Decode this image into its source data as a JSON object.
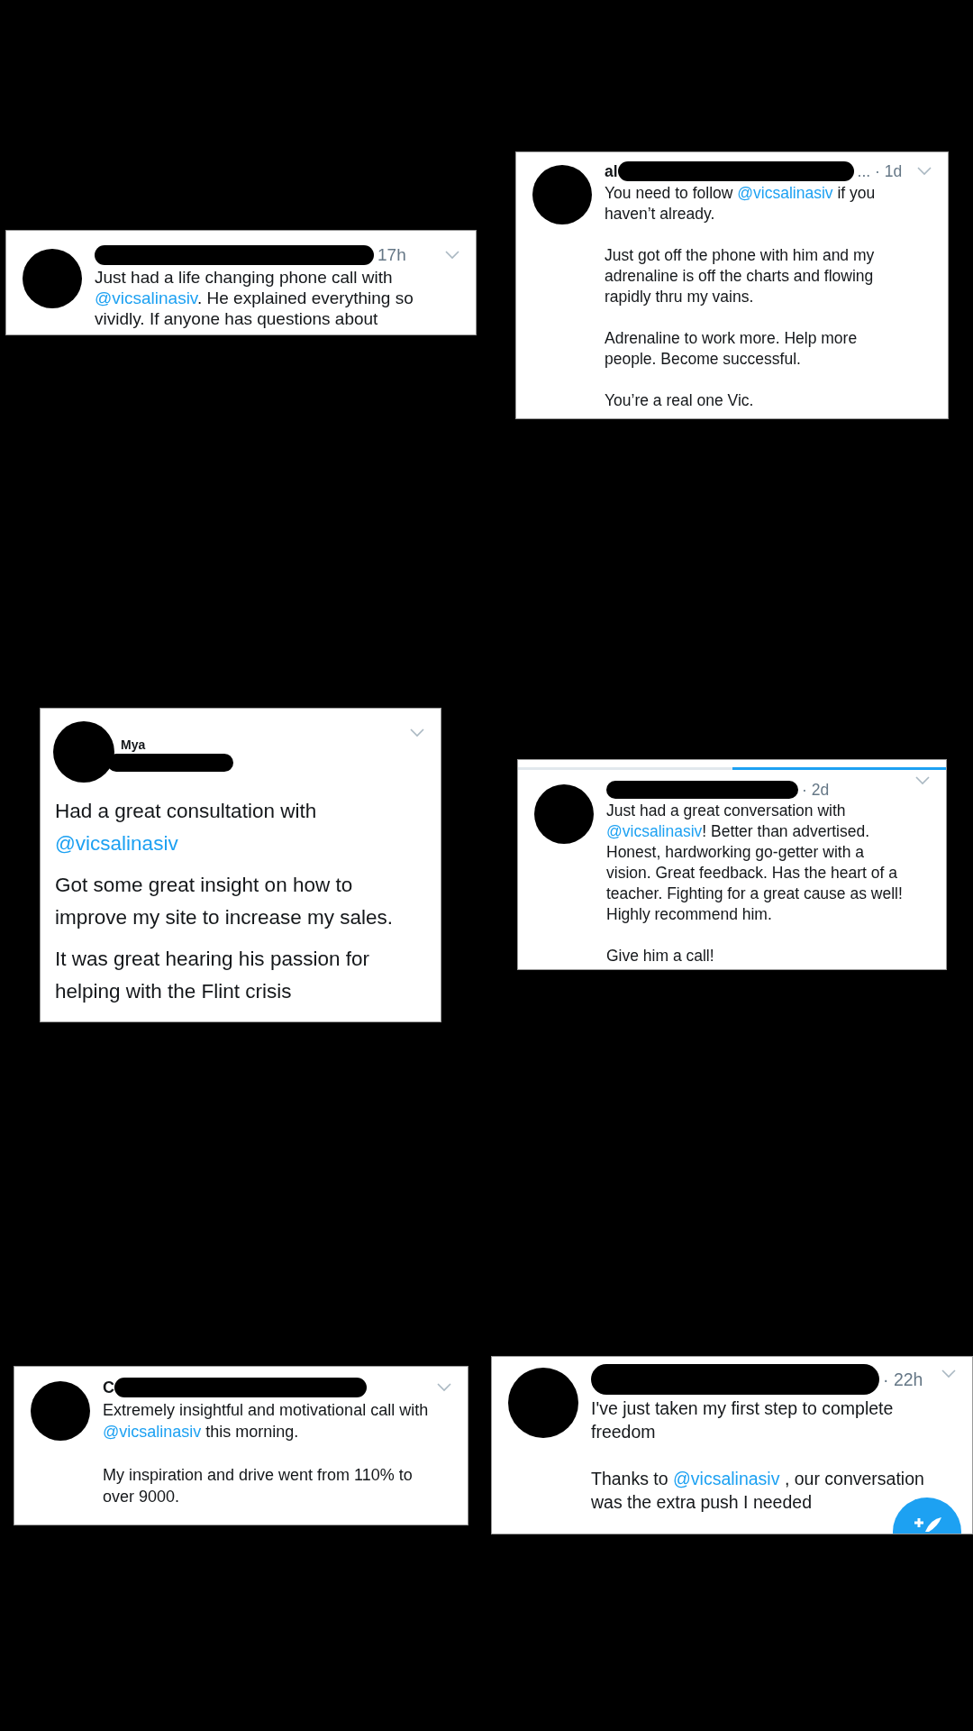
{
  "tweets": [
    {
      "kind": "compact",
      "redacted": true,
      "time": "17h",
      "paragraphs": [
        [
          {
            "kind": "text",
            "text": "Just had a life changing phone call with "
          },
          {
            "kind": "mention",
            "text": "@vicsalinasiv"
          },
          {
            "kind": "text",
            "text": ". He explained everything so vividly. If anyone has questions about"
          }
        ]
      ]
    },
    {
      "kind": "compact",
      "name": "al",
      "redacted": true,
      "time": "... · 1d",
      "paragraphs": [
        [
          {
            "kind": "text",
            "text": "You need to follow "
          },
          {
            "kind": "mention",
            "text": "@vicsalinasiv"
          },
          {
            "kind": "text",
            "text": " if you haven’t already."
          }
        ],
        [
          {
            "kind": "text",
            "text": "Just got off the phone with him and my adrenaline is off the charts and flowing rapidly thru my vains."
          }
        ],
        [
          {
            "kind": "text",
            "text": "Adrenaline to work more. Help more people. Become successful."
          }
        ],
        [
          {
            "kind": "text",
            "text": "You’re a real one Vic."
          }
        ]
      ]
    },
    {
      "kind": "large",
      "name": "Mya",
      "redacted": true,
      "paragraphs": [
        [
          {
            "kind": "text",
            "text": "Had a great consultation with "
          },
          {
            "kind": "mention",
            "text": "@vicsalinasiv"
          }
        ],
        [
          {
            "kind": "text",
            "text": "Got some great insight on how to improve my site to increase my sales."
          }
        ],
        [
          {
            "kind": "text",
            "text": "It was great hearing his passion for helping with the Flint crisis"
          }
        ]
      ]
    },
    {
      "kind": "compact",
      "redacted": true,
      "time": "· 2d",
      "tab_strip": [
        {
          "selected": false
        },
        {
          "selected": true
        }
      ],
      "paragraphs": [
        [
          {
            "kind": "text",
            "text": "Just had a great conversation with "
          },
          {
            "kind": "mention",
            "text": "@vicsalinasiv"
          },
          {
            "kind": "text",
            "text": "! Better than advertised. Honest, hardworking go-getter with a vision. Great feedback. Has the heart of a teacher. Fighting for a great cause as well! Highly recommend him."
          }
        ],
        [
          {
            "kind": "text",
            "text": "Give him a call!"
          }
        ]
      ]
    },
    {
      "kind": "compact",
      "name": "C",
      "redacted": true,
      "paragraphs": [
        [
          {
            "kind": "text",
            "text": "Extremely insightful and motivational call with "
          },
          {
            "kind": "mention",
            "text": "@vicsalinasiv"
          },
          {
            "kind": "text",
            "text": " this morning."
          }
        ],
        [
          {
            "kind": "text",
            "text": "My inspiration and drive went from 110% to over 9000."
          }
        ]
      ]
    },
    {
      "kind": "compact",
      "redacted": true,
      "time": "· 22h",
      "compose_button": true,
      "paragraphs": [
        [
          {
            "kind": "text",
            "text": "I've just taken my first step to complete freedom"
          }
        ],
        [
          {
            "kind": "text",
            "text": "Thanks to "
          },
          {
            "kind": "mention",
            "text": "@vicsalinasiv"
          },
          {
            "kind": "text",
            "text": " , our conversation was the extra push I needed"
          }
        ]
      ]
    }
  ]
}
